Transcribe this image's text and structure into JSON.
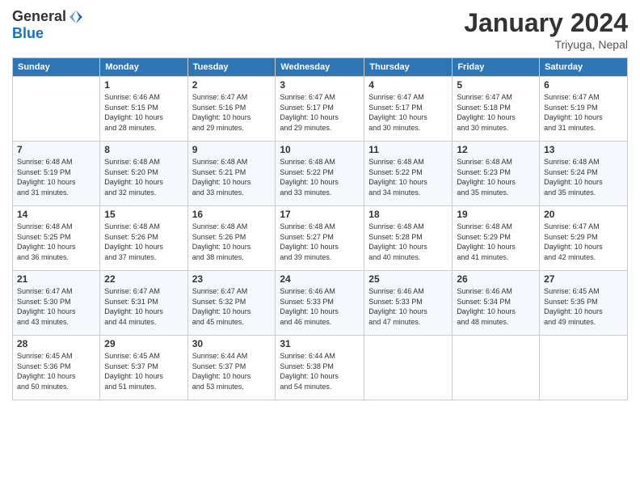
{
  "header": {
    "logo": {
      "general": "General",
      "blue": "Blue"
    },
    "title": "January 2024",
    "subtitle": "Triyuga, Nepal"
  },
  "calendar": {
    "days": [
      "Sunday",
      "Monday",
      "Tuesday",
      "Wednesday",
      "Thursday",
      "Friday",
      "Saturday"
    ],
    "weeks": [
      [
        {
          "day": "",
          "info": ""
        },
        {
          "day": "1",
          "info": "Sunrise: 6:46 AM\nSunset: 5:15 PM\nDaylight: 10 hours\nand 28 minutes."
        },
        {
          "day": "2",
          "info": "Sunrise: 6:47 AM\nSunset: 5:16 PM\nDaylight: 10 hours\nand 29 minutes."
        },
        {
          "day": "3",
          "info": "Sunrise: 6:47 AM\nSunset: 5:17 PM\nDaylight: 10 hours\nand 29 minutes."
        },
        {
          "day": "4",
          "info": "Sunrise: 6:47 AM\nSunset: 5:17 PM\nDaylight: 10 hours\nand 30 minutes."
        },
        {
          "day": "5",
          "info": "Sunrise: 6:47 AM\nSunset: 5:18 PM\nDaylight: 10 hours\nand 30 minutes."
        },
        {
          "day": "6",
          "info": "Sunrise: 6:47 AM\nSunset: 5:19 PM\nDaylight: 10 hours\nand 31 minutes."
        }
      ],
      [
        {
          "day": "7",
          "info": "Sunrise: 6:48 AM\nSunset: 5:19 PM\nDaylight: 10 hours\nand 31 minutes."
        },
        {
          "day": "8",
          "info": "Sunrise: 6:48 AM\nSunset: 5:20 PM\nDaylight: 10 hours\nand 32 minutes."
        },
        {
          "day": "9",
          "info": "Sunrise: 6:48 AM\nSunset: 5:21 PM\nDaylight: 10 hours\nand 33 minutes."
        },
        {
          "day": "10",
          "info": "Sunrise: 6:48 AM\nSunset: 5:22 PM\nDaylight: 10 hours\nand 33 minutes."
        },
        {
          "day": "11",
          "info": "Sunrise: 6:48 AM\nSunset: 5:22 PM\nDaylight: 10 hours\nand 34 minutes."
        },
        {
          "day": "12",
          "info": "Sunrise: 6:48 AM\nSunset: 5:23 PM\nDaylight: 10 hours\nand 35 minutes."
        },
        {
          "day": "13",
          "info": "Sunrise: 6:48 AM\nSunset: 5:24 PM\nDaylight: 10 hours\nand 35 minutes."
        }
      ],
      [
        {
          "day": "14",
          "info": "Sunrise: 6:48 AM\nSunset: 5:25 PM\nDaylight: 10 hours\nand 36 minutes."
        },
        {
          "day": "15",
          "info": "Sunrise: 6:48 AM\nSunset: 5:26 PM\nDaylight: 10 hours\nand 37 minutes."
        },
        {
          "day": "16",
          "info": "Sunrise: 6:48 AM\nSunset: 5:26 PM\nDaylight: 10 hours\nand 38 minutes."
        },
        {
          "day": "17",
          "info": "Sunrise: 6:48 AM\nSunset: 5:27 PM\nDaylight: 10 hours\nand 39 minutes."
        },
        {
          "day": "18",
          "info": "Sunrise: 6:48 AM\nSunset: 5:28 PM\nDaylight: 10 hours\nand 40 minutes."
        },
        {
          "day": "19",
          "info": "Sunrise: 6:48 AM\nSunset: 5:29 PM\nDaylight: 10 hours\nand 41 minutes."
        },
        {
          "day": "20",
          "info": "Sunrise: 6:47 AM\nSunset: 5:29 PM\nDaylight: 10 hours\nand 42 minutes."
        }
      ],
      [
        {
          "day": "21",
          "info": "Sunrise: 6:47 AM\nSunset: 5:30 PM\nDaylight: 10 hours\nand 43 minutes."
        },
        {
          "day": "22",
          "info": "Sunrise: 6:47 AM\nSunset: 5:31 PM\nDaylight: 10 hours\nand 44 minutes."
        },
        {
          "day": "23",
          "info": "Sunrise: 6:47 AM\nSunset: 5:32 PM\nDaylight: 10 hours\nand 45 minutes."
        },
        {
          "day": "24",
          "info": "Sunrise: 6:46 AM\nSunset: 5:33 PM\nDaylight: 10 hours\nand 46 minutes."
        },
        {
          "day": "25",
          "info": "Sunrise: 6:46 AM\nSunset: 5:33 PM\nDaylight: 10 hours\nand 47 minutes."
        },
        {
          "day": "26",
          "info": "Sunrise: 6:46 AM\nSunset: 5:34 PM\nDaylight: 10 hours\nand 48 minutes."
        },
        {
          "day": "27",
          "info": "Sunrise: 6:45 AM\nSunset: 5:35 PM\nDaylight: 10 hours\nand 49 minutes."
        }
      ],
      [
        {
          "day": "28",
          "info": "Sunrise: 6:45 AM\nSunset: 5:36 PM\nDaylight: 10 hours\nand 50 minutes."
        },
        {
          "day": "29",
          "info": "Sunrise: 6:45 AM\nSunset: 5:37 PM\nDaylight: 10 hours\nand 51 minutes."
        },
        {
          "day": "30",
          "info": "Sunrise: 6:44 AM\nSunset: 5:37 PM\nDaylight: 10 hours\nand 53 minutes."
        },
        {
          "day": "31",
          "info": "Sunrise: 6:44 AM\nSunset: 5:38 PM\nDaylight: 10 hours\nand 54 minutes."
        },
        {
          "day": "",
          "info": ""
        },
        {
          "day": "",
          "info": ""
        },
        {
          "day": "",
          "info": ""
        }
      ]
    ]
  }
}
